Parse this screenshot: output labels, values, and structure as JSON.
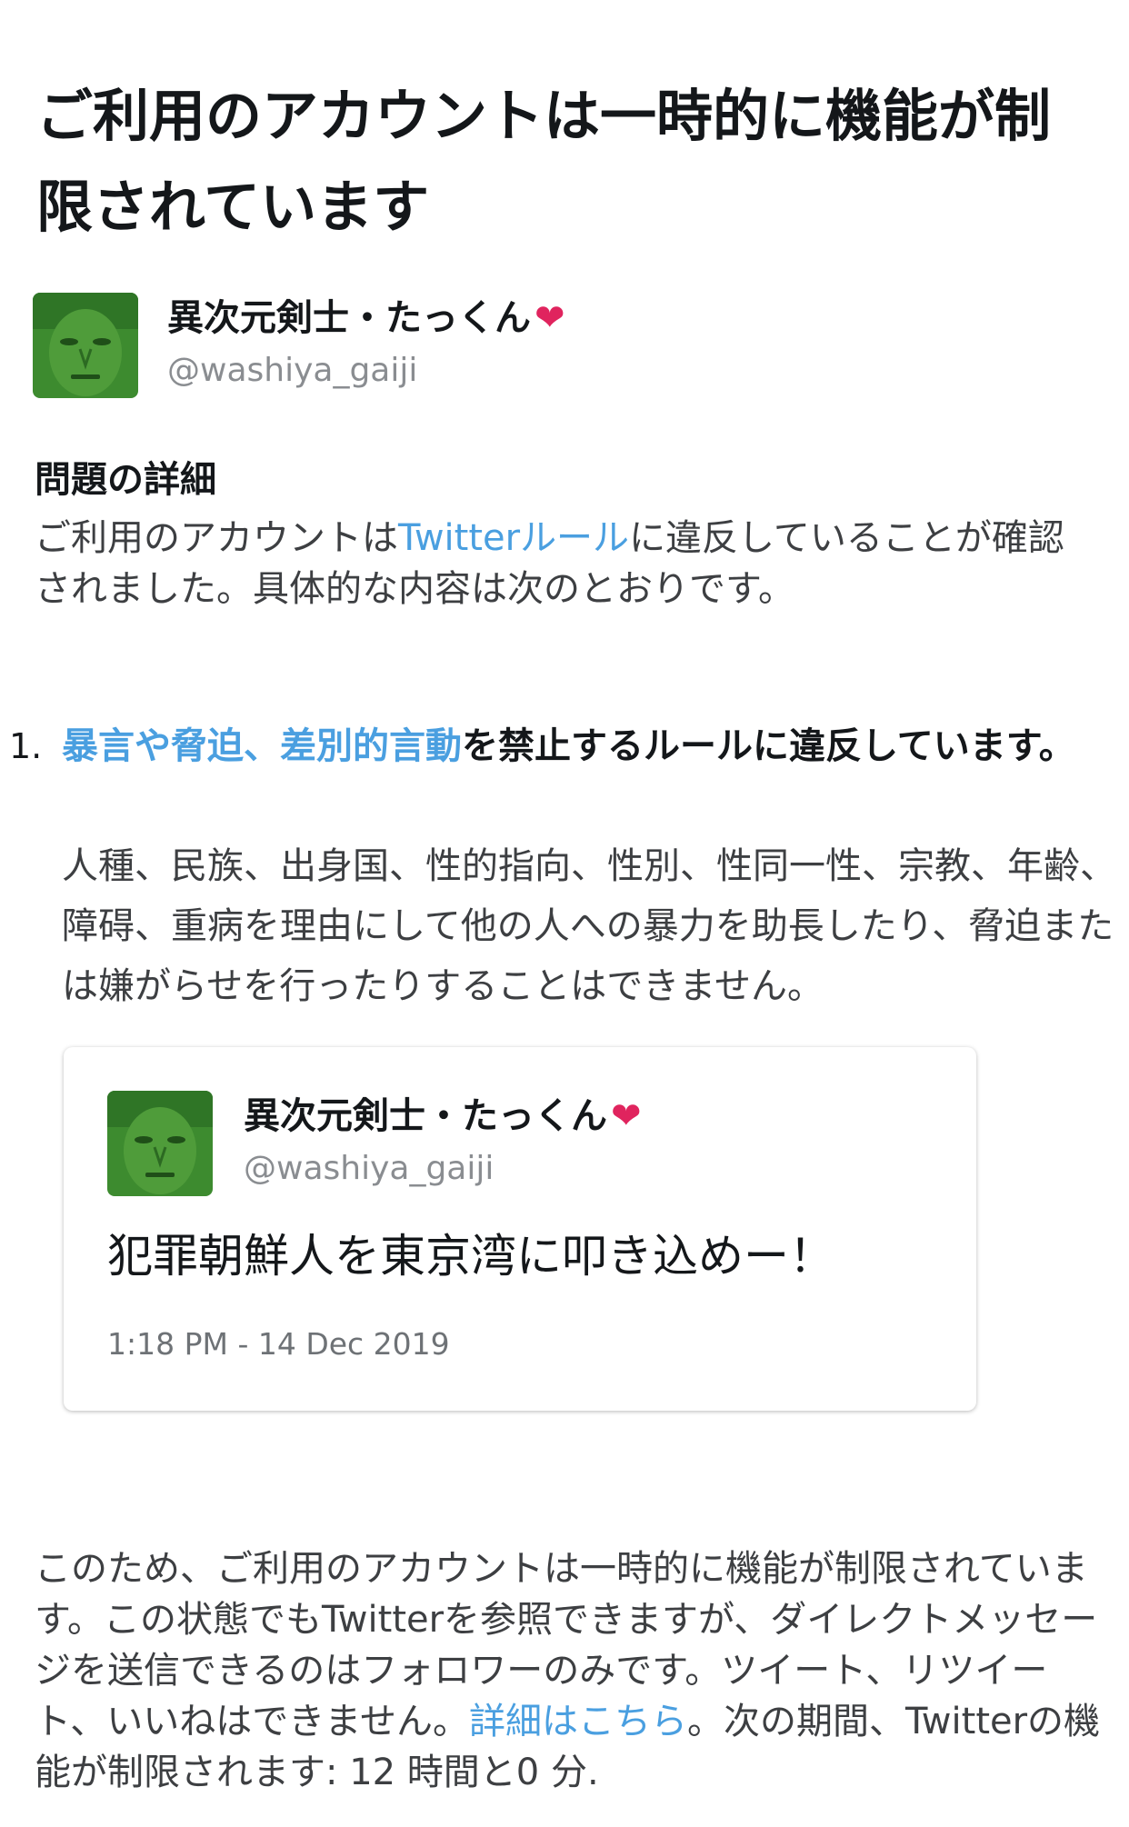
{
  "title": "ご利用のアカウントは一時的に機能が制限されています",
  "user": {
    "name": "異次元剣士・たっくん",
    "heart": "❤",
    "handle": "@washiya_gaiji"
  },
  "details": {
    "heading": "問題の詳細",
    "intro_before": "ご利用のアカウントは",
    "intro_link": "Twitterルール",
    "intro_after": "に違反していることが確認されました。具体的な内容は次のとおりです。"
  },
  "violation": {
    "number": "1.",
    "link": "暴言や脅迫、差別的言動",
    "heading_after": "を禁止するルールに違反しています。",
    "body": "人種、民族、出身国、性的指向、性別、性同一性、宗教、年齢、障碍、重病を理由にして他の人への暴力を助長したり、脅迫または嫌がらせを行ったりすることはできません。"
  },
  "tweet": {
    "name": "異次元剣士・たっくん",
    "heart": "❤",
    "handle": "@washiya_gaiji",
    "text": "犯罪朝鮮人を東京湾に叩き込めー！",
    "timestamp": "1:18 PM - 14 Dec 2019"
  },
  "footer": {
    "text_before": "このため、ご利用のアカウントは一時的に機能が制限されています。この状態でもTwitterを参照できますが、ダイレクトメッセージを送信できるのはフォロワーのみです。ツイート、リツイート、いいねはできません。",
    "link": "詳細はこちら",
    "text_after": "。次の期間、Twitterの機能が制限されます: 12 時間と0 分."
  },
  "colors": {
    "link": "#4a9fe0",
    "heart": "#e0245e",
    "avatar_green": "#3d8b2f"
  }
}
